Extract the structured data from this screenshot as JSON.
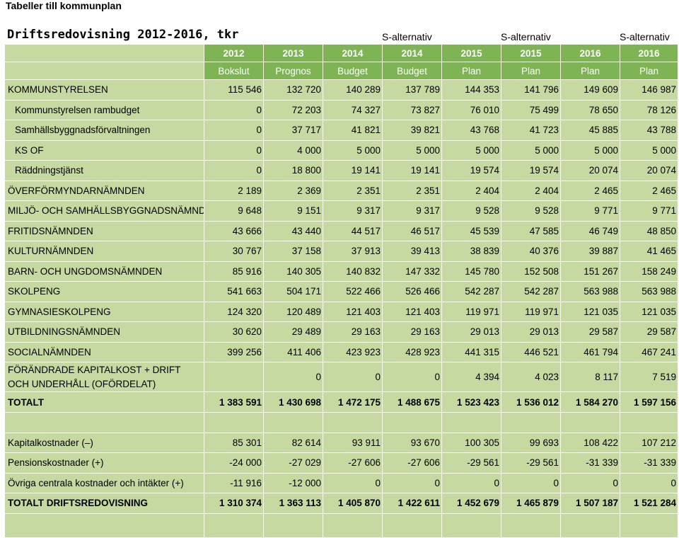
{
  "header": {
    "top_title": "Tabeller till kommunplan",
    "main_title": "Driftsredovisning 2012-2016, tkr",
    "alternative_label": "S-alternativ"
  },
  "table": {
    "years": [
      "2012",
      "2013",
      "2014",
      "2014",
      "2015",
      "2015",
      "2016",
      "2016"
    ],
    "types": [
      "Bokslut",
      "Prognos",
      "Budget",
      "Budget",
      "Plan",
      "Plan",
      "Plan",
      "Plan"
    ],
    "rows": [
      {
        "label": "KOMMUNSTYRELSEN",
        "values": [
          "115 546",
          "132 720",
          "140 289",
          "137 789",
          "144 353",
          "141 796",
          "149 609",
          "146 987"
        ]
      },
      {
        "label": "Kommunstyrelsen rambudget",
        "values": [
          "0",
          "72 203",
          "74 327",
          "73 827",
          "76 010",
          "75 499",
          "78 650",
          "78 126"
        ]
      },
      {
        "label": "Samhällsbyggnadsförvaltningen",
        "values": [
          "0",
          "37 717",
          "41 821",
          "39 821",
          "43 768",
          "41 723",
          "45 885",
          "43 788"
        ]
      },
      {
        "label": "KS OF",
        "values": [
          "0",
          "4 000",
          "5 000",
          "5 000",
          "5 000",
          "5 000",
          "5 000",
          "5 000"
        ]
      },
      {
        "label": "Räddningstjänst",
        "values": [
          "0",
          "18 800",
          "19 141",
          "19 141",
          "19 574",
          "19 574",
          "20 074",
          "20 074"
        ]
      },
      {
        "label": "ÖVERFÖRMYNDARNÄMNDEN",
        "values": [
          "2 189",
          "2 369",
          "2 351",
          "2 351",
          "2 404",
          "2 404",
          "2 465",
          "2 465"
        ]
      },
      {
        "label": "MILJÖ- OCH SAMHÄLLSBYGGNADSNÄMNDEN",
        "values": [
          "9 648",
          "9 151",
          "9 317",
          "9 317",
          "9 528",
          "9 528",
          "9 771",
          "9 771"
        ]
      },
      {
        "label": "FRITIDSNÄMNDEN",
        "values": [
          "43 666",
          "43 440",
          "44 517",
          "46 517",
          "45 539",
          "47 585",
          "46 749",
          "48 850"
        ]
      },
      {
        "label": "KULTURNÄMNDEN",
        "values": [
          "30 767",
          "37 158",
          "37 913",
          "39 413",
          "38 839",
          "40 376",
          "39 887",
          "41 465"
        ]
      },
      {
        "label": "BARN- OCH UNGDOMSNÄMNDEN",
        "values": [
          "85 916",
          "140 305",
          "140 832",
          "147 332",
          "145 780",
          "152 508",
          "151 267",
          "158 249"
        ]
      },
      {
        "label": "SKOLPENG",
        "values": [
          "541 663",
          "504 171",
          "522 466",
          "526 466",
          "542 287",
          "542 287",
          "563 988",
          "563 988"
        ]
      },
      {
        "label": "GYMNASIESKOLPENG",
        "values": [
          "124 320",
          "120 489",
          "121 403",
          "121 403",
          "119 971",
          "119 971",
          "121 035",
          "121 035"
        ]
      },
      {
        "label": "UTBILDNINGSNÄMNDEN",
        "values": [
          "30 620",
          "29 489",
          "29 163",
          "29 163",
          "29 013",
          "29 013",
          "29 587",
          "29 587"
        ]
      },
      {
        "label": "SOCIALNÄMNDEN",
        "values": [
          "399 256",
          "411 406",
          "423 923",
          "428 923",
          "441 315",
          "446 521",
          "461 794",
          "467 241"
        ]
      },
      {
        "label": "FÖRÄNDRADE KAPITALKOST + DRIFT OCH UNDERHÅLL (OFÖRDELAT)",
        "values": [
          "",
          "",
          "0",
          "0",
          "0",
          "4 394",
          "4 023",
          "8 117",
          "7 519"
        ]
      },
      {
        "label": "TOTALT",
        "values": [
          "1 383 591",
          "1 430 698",
          "1 472 175",
          "1 488 675",
          "1 523 423",
          "1 536 012",
          "1 584 270",
          "1 597 156"
        ]
      },
      {
        "label": "Kapitalkostnader (–)",
        "values": [
          "85 301",
          "82 614",
          "93 911",
          "93 670",
          "100 305",
          "99 693",
          "108 422",
          "107 212"
        ]
      },
      {
        "label": "Pensionskostnader (+)",
        "values": [
          "-24 000",
          "-27 029",
          "-27 606",
          "-27 606",
          "-29 561",
          "-29 561",
          "-31 339",
          "-31 339"
        ]
      },
      {
        "label": "Övriga centrala kostnader och intäkter (+)",
        "values": [
          "-11 916",
          "-12 000",
          "0",
          "0",
          "0",
          "0",
          "0",
          "0"
        ]
      },
      {
        "label": "TOTALT DRIFTSREDOVISNING",
        "values": [
          "1 310 374",
          "1 363 113",
          "1 405 870",
          "1 422 611",
          "1 452 679",
          "1 465 879",
          "1 507 187",
          "1 521 284"
        ]
      }
    ]
  },
  "colors": {
    "header_green": "#7eb453",
    "cell_green": "#c5d9a1"
  }
}
